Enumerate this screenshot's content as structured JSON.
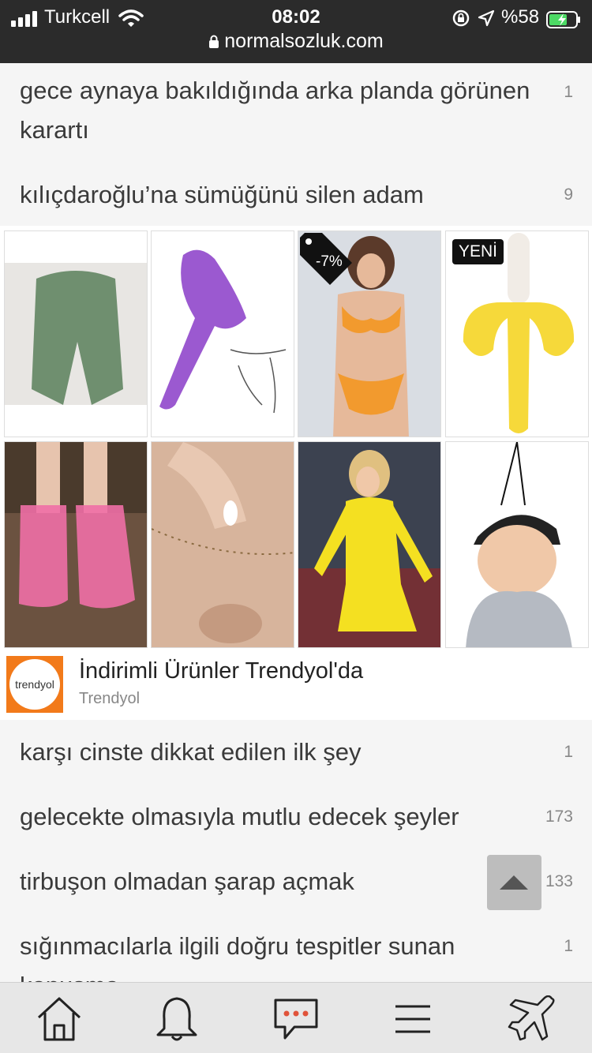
{
  "status_bar": {
    "carrier": "Turkcell",
    "time": "08:02",
    "battery": "%58",
    "url": "normalsozluk.com"
  },
  "topics_top": [
    {
      "title": "gece aynaya bakıldığında arka planda görünen karartı",
      "count": "1"
    },
    {
      "title": "kılıçdaroğlu’na sümüğünü silen adam",
      "count": "9"
    }
  ],
  "ad": {
    "badge_new": "YENİ",
    "discount": "-7%",
    "logo_text": "trendyol",
    "title": "İndirimli Ürünler Trendyol'da",
    "advertiser": "Trendyol",
    "products": [
      "leggings",
      "funnel",
      "bikini",
      "teether",
      "boots",
      "waist-chain",
      "yellow-dress",
      "car-freshener"
    ]
  },
  "topics_bottom": [
    {
      "title": "karşı cinste dikkat edilen ilk şey",
      "count": "1"
    },
    {
      "title": "gelecekte olmasıyla mutlu edecek şeyler",
      "count": "173"
    },
    {
      "title": "tirbuşon olmadan şarap açmak",
      "count": "133"
    },
    {
      "title": "sığınmacılarla ilgili doğru tespitler sunan konuşma",
      "count": "1"
    }
  ],
  "nav": [
    "home-icon",
    "bell-icon",
    "message-icon",
    "menu-icon",
    "plane-icon"
  ],
  "colors": {
    "status_bg": "#2b2b2b",
    "brand": "#f27a1a",
    "page_bg": "#f5f5f5"
  }
}
